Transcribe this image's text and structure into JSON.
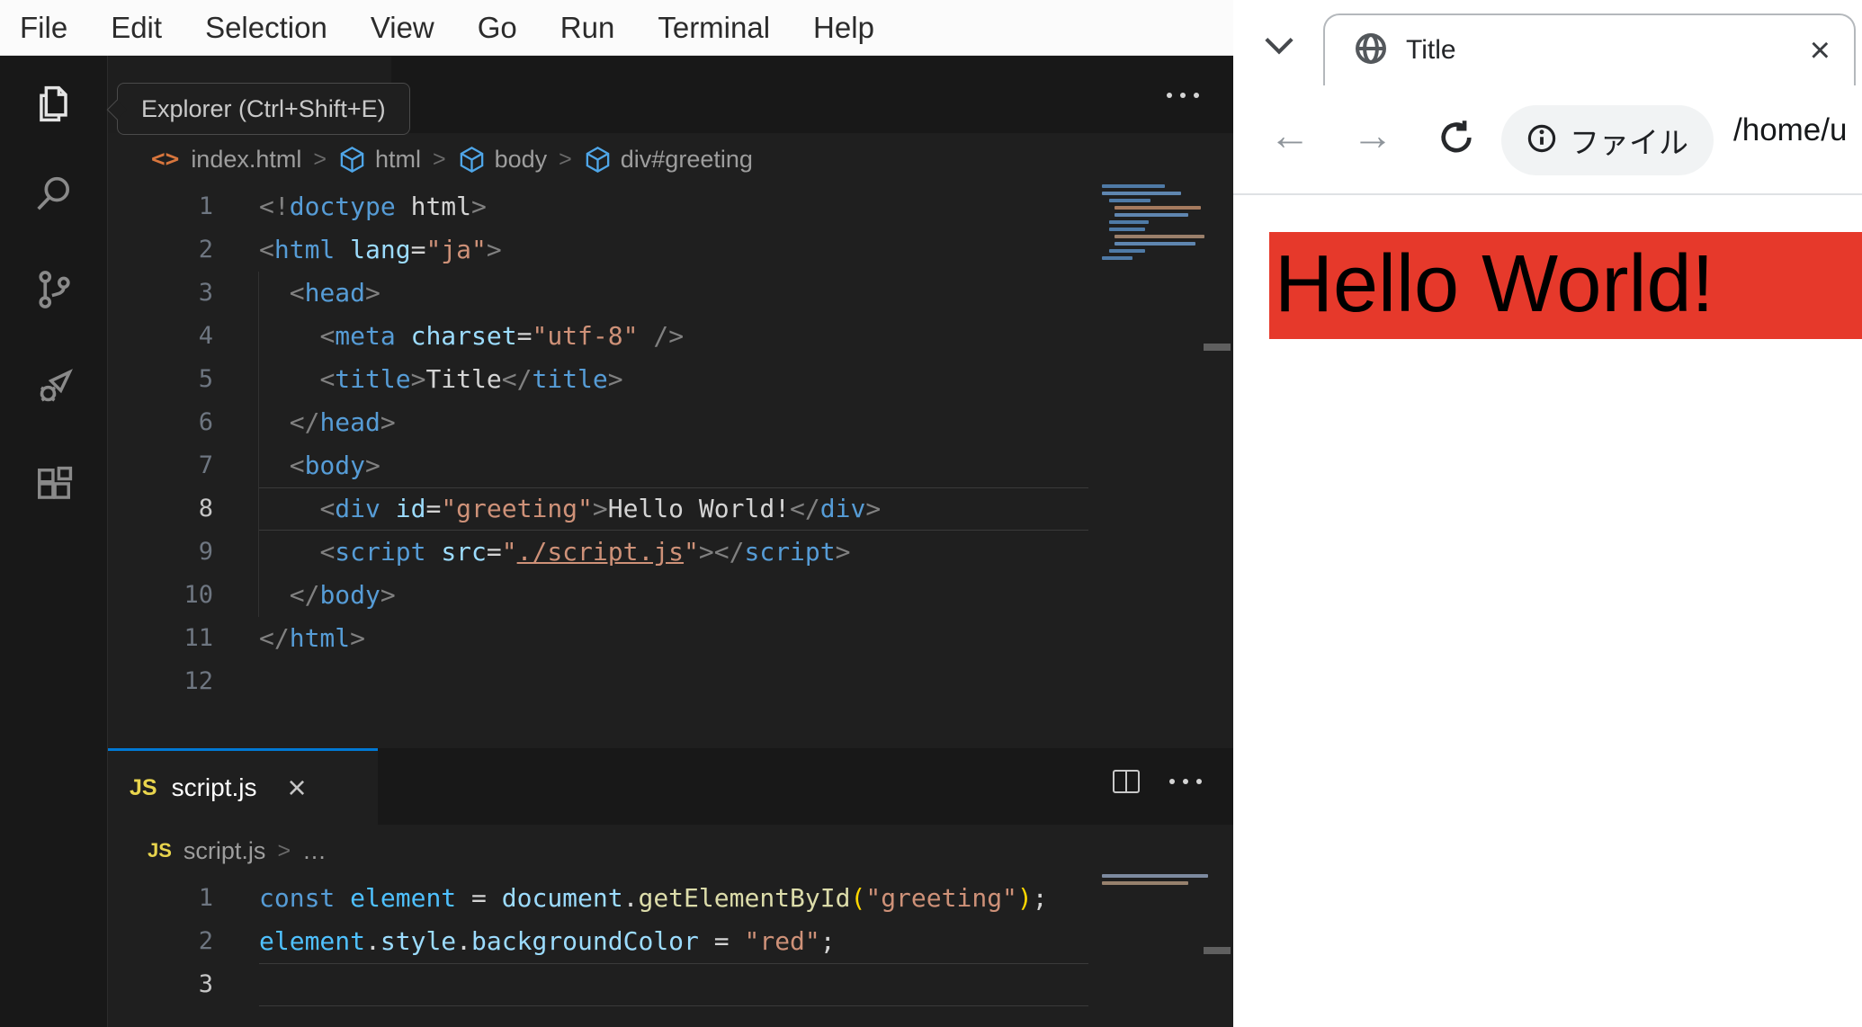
{
  "colors": {
    "accent_blue": "#0078d4",
    "editor_bg": "#1f1f1f",
    "chrome_bg": "#181818",
    "menubar_bg": "#fbfbfb",
    "page_red": "#e6392b",
    "js_yellow": "#e8d44d"
  },
  "vscode": {
    "menubar": [
      "File",
      "Edit",
      "Selection",
      "View",
      "Go",
      "Run",
      "Terminal",
      "Help"
    ],
    "tooltip": "Explorer (Ctrl+Shift+E)",
    "activity_icons": [
      "explorer",
      "search",
      "source-control",
      "run-and-debug",
      "extensions"
    ],
    "top_breadcrumb": {
      "file_icon": "<>",
      "file": "index.html",
      "segments": [
        "html",
        "body",
        "div#greeting"
      ]
    },
    "bottom_tab": {
      "badge": "JS",
      "label": "script.js",
      "close": "×"
    },
    "bottom_breadcrumb": {
      "badge": "JS",
      "file": "script.js",
      "more": "…"
    },
    "editors": [
      {
        "id": "code-top",
        "active_line": 8,
        "lines": [
          {
            "tokens": [
              [
                "<!",
                "p"
              ],
              [
                "doctype",
                "t"
              ],
              [
                " html",
                "w"
              ],
              [
                ">",
                "p"
              ]
            ]
          },
          {
            "tokens": [
              [
                "<",
                "p"
              ],
              [
                "html",
                "t"
              ],
              [
                " ",
                "w"
              ],
              [
                "lang",
                "a"
              ],
              [
                "=",
                "w"
              ],
              [
                "\"ja\"",
                "s"
              ],
              [
                ">",
                "p"
              ]
            ]
          },
          {
            "tokens": [
              [
                "  ",
                "w"
              ],
              [
                "<",
                "p"
              ],
              [
                "head",
                "t"
              ],
              [
                ">",
                "p"
              ]
            ]
          },
          {
            "tokens": [
              [
                "    ",
                "w"
              ],
              [
                "<",
                "p"
              ],
              [
                "meta",
                "t"
              ],
              [
                " ",
                "w"
              ],
              [
                "charset",
                "a"
              ],
              [
                "=",
                "w"
              ],
              [
                "\"utf-8\"",
                "s"
              ],
              [
                " />",
                "p"
              ]
            ]
          },
          {
            "tokens": [
              [
                "    ",
                "w"
              ],
              [
                "<",
                "p"
              ],
              [
                "title",
                "t"
              ],
              [
                ">",
                "p"
              ],
              [
                "Title",
                "w"
              ],
              [
                "</",
                "p"
              ],
              [
                "title",
                "t"
              ],
              [
                ">",
                "p"
              ]
            ]
          },
          {
            "tokens": [
              [
                "  ",
                "w"
              ],
              [
                "</",
                "p"
              ],
              [
                "head",
                "t"
              ],
              [
                ">",
                "p"
              ]
            ]
          },
          {
            "tokens": [
              [
                "  ",
                "w"
              ],
              [
                "<",
                "p"
              ],
              [
                "body",
                "t"
              ],
              [
                ">",
                "p"
              ]
            ]
          },
          {
            "tokens": [
              [
                "    ",
                "w"
              ],
              [
                "<",
                "p"
              ],
              [
                "div",
                "t"
              ],
              [
                " ",
                "w"
              ],
              [
                "id",
                "a"
              ],
              [
                "=",
                "w"
              ],
              [
                "\"greeting\"",
                "s"
              ],
              [
                ">",
                "p"
              ],
              [
                "Hello World!",
                "w"
              ],
              [
                "</",
                "p"
              ],
              [
                "div",
                "t"
              ],
              [
                ">",
                "p"
              ]
            ]
          },
          {
            "tokens": [
              [
                "    ",
                "w"
              ],
              [
                "<",
                "p"
              ],
              [
                "script",
                "t"
              ],
              [
                " ",
                "w"
              ],
              [
                "src",
                "a"
              ],
              [
                "=",
                "w"
              ],
              [
                "\"",
                "s"
              ],
              [
                "./script.js",
                "u"
              ],
              [
                "\"",
                "s"
              ],
              [
                ">",
                "p"
              ],
              [
                "</",
                "p"
              ],
              [
                "script",
                "t"
              ],
              [
                ">",
                "p"
              ]
            ]
          },
          {
            "tokens": [
              [
                "  ",
                "w"
              ],
              [
                "</",
                "p"
              ],
              [
                "body",
                "t"
              ],
              [
                ">",
                "p"
              ]
            ]
          },
          {
            "tokens": [
              [
                "</",
                "p"
              ],
              [
                "html",
                "t"
              ],
              [
                ">",
                "p"
              ]
            ]
          },
          {
            "tokens": []
          }
        ]
      },
      {
        "id": "code-bot",
        "active_line": 3,
        "lines": [
          {
            "tokens": [
              [
                "const",
                "k"
              ],
              [
                " ",
                "w"
              ],
              [
                "element",
                "c"
              ],
              [
                " = ",
                "w"
              ],
              [
                "document",
                "v"
              ],
              [
                ".",
                "w"
              ],
              [
                "getElementById",
                "f"
              ],
              [
                "(",
                "b"
              ],
              [
                "\"greeting\"",
                "s"
              ],
              [
                ")",
                "b"
              ],
              [
                ";",
                "w"
              ]
            ]
          },
          {
            "tokens": [
              [
                "element",
                "c"
              ],
              [
                ".",
                "w"
              ],
              [
                "style",
                "v"
              ],
              [
                ".",
                "w"
              ],
              [
                "backgroundColor",
                "v"
              ],
              [
                " = ",
                "w"
              ],
              [
                "\"red\"",
                "s"
              ],
              [
                ";",
                "w"
              ]
            ]
          },
          {
            "tokens": []
          }
        ]
      }
    ]
  },
  "browser": {
    "tab": {
      "title": "Title",
      "close": "×"
    },
    "toolbar": {
      "back": "←",
      "forward": "→",
      "chip_label": "ファイル",
      "url": "/home/u"
    },
    "page": {
      "greeting": "Hello World!"
    }
  }
}
